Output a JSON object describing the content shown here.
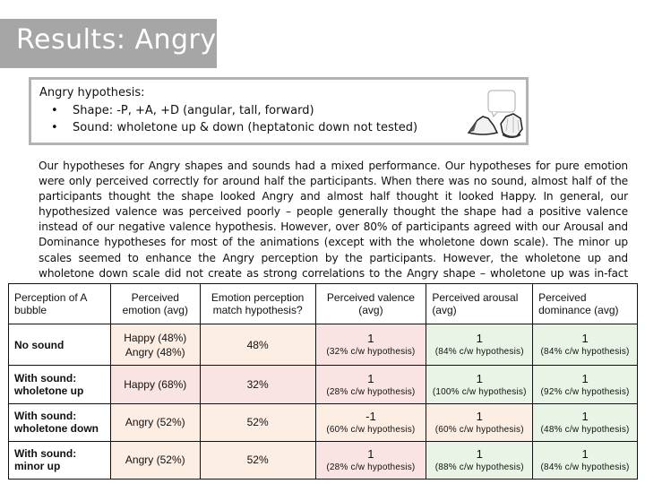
{
  "title": "Results: Angry",
  "hypothesis": {
    "heading": "Angry hypothesis:",
    "bullet": "•",
    "items": [
      "Shape:  -P, +A, +D (angular, tall, forward)",
      "Sound:  wholetone up & down (heptatonic down not tested)"
    ],
    "image_description": "two angular rock-like shapes with a speech bubble"
  },
  "paragraph": "Our hypotheses for Angry shapes and sounds had a mixed performance.  Our hypotheses for pure emotion were only perceived correctly for around half the participants.  When there was no sound, almost half of the participants thought the shape looked Angry and almost half thought it looked Happy.  In general, our hypothesized valence was perceived poorly – people generally thought the shape had a positive valence instead of our negative valence hypothesis.  However, over 80% of participants agreed with our Arousal and Dominance hypotheses for most of the animations (except with the wholetone down scale).  The minor up scales seemed to enhance the Angry perception by the participants.  However, the wholetone up and wholetone down scale did not create as strong correlations to the Angry shape – wholetone up was in-fact considered Happy rather than Angry.",
  "table": {
    "headers": [
      "Perception of A bubble",
      "Perceived emotion (avg)",
      "Emotion perception match hypothesis?",
      "Perceived valence (avg)",
      "Perceived arousal (avg)",
      "Perceived dominance (avg)"
    ],
    "rows": [
      {
        "label": "No sound",
        "emotion": [
          "Happy (48%)",
          "Angry (48%)"
        ],
        "match": "48%",
        "valence": {
          "value": "1",
          "note": "(32% c/w hypothesis)"
        },
        "arousal": {
          "value": "1",
          "note": "(84% c/w hypothesis)"
        },
        "dominance": {
          "value": "1",
          "note": "(84% c/w hypothesis)"
        }
      },
      {
        "label": "With sound: wholetone up",
        "emotion": [
          "Happy (68%)"
        ],
        "match": "32%",
        "valence": {
          "value": "1",
          "note": "(28% c/w hypothesis)"
        },
        "arousal": {
          "value": "1",
          "note": "(100% c/w hypothesis)"
        },
        "dominance": {
          "value": "1",
          "note": "(92% c/w hypothesis)"
        }
      },
      {
        "label": "With sound: wholetone down",
        "emotion": [
          "Angry (52%)"
        ],
        "match": "52%",
        "valence": {
          "value": "-1",
          "note": "(60% c/w hypothesis)"
        },
        "arousal": {
          "value": "1",
          "note": "(60% c/w hypothesis)"
        },
        "dominance": {
          "value": "1",
          "note": "(48% c/w hypothesis)"
        }
      },
      {
        "label": "With sound: minor up",
        "emotion": [
          "Angry (52%)"
        ],
        "match": "52%",
        "valence": {
          "value": "1",
          "note": "(28% c/w hypothesis)"
        },
        "arousal": {
          "value": "1",
          "note": "(88% c/w hypothesis)"
        },
        "dominance": {
          "value": "1",
          "note": "(84% c/w hypothesis)"
        }
      }
    ]
  },
  "colors": {
    "title_bar": "#a6a6a6",
    "peach": "#fdeee4",
    "pink": "#f9e3e3",
    "green": "#e9f3e6"
  }
}
